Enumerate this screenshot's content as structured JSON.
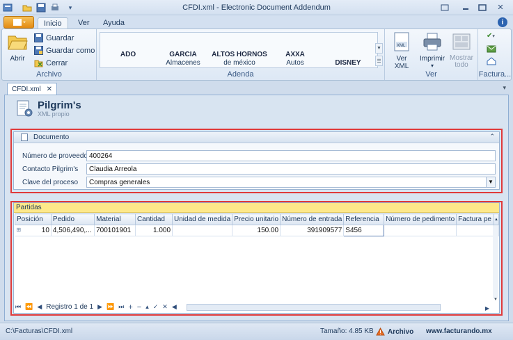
{
  "window": {
    "title": "CFDI.xml - Electronic Document Addendum"
  },
  "ribbon_tabs": [
    {
      "label": "Inicio",
      "active": true
    },
    {
      "label": "Ver",
      "active": false
    },
    {
      "label": "Ayuda",
      "active": false
    }
  ],
  "archivo": {
    "group_label": "Archivo",
    "abrir": "Abrir",
    "guardar": "Guardar",
    "guardar_como": "Guardar como",
    "cerrar": "Cerrar"
  },
  "adenda": {
    "group_label": "Adenda",
    "items": [
      {
        "name": "ADO",
        "sub": ""
      },
      {
        "name": "GARCIA",
        "sub": "Almacenes"
      },
      {
        "name": "ALTOS HORNOS",
        "sub": "de méxico"
      },
      {
        "name": "AXXA",
        "sub": "Autos"
      },
      {
        "name": "DISNEY",
        "sub": ""
      }
    ]
  },
  "ver": {
    "group_label": "Ver",
    "ver_xml": "Ver XML",
    "imprimir": "Imprimir",
    "mostrar_todo_1": "Mostrar",
    "mostrar_todo_2": "todo"
  },
  "factura": {
    "group_label": "Factura..."
  },
  "doc_tab": {
    "label": "CFDI.xml"
  },
  "header": {
    "title": "Pilgrim's",
    "subtitle": "XML propio"
  },
  "documento": {
    "title": "Documento",
    "fields": [
      {
        "label": "Número de proveedor",
        "value": "400264"
      },
      {
        "label": "Contacto Pilgrim's",
        "value": "Claudia Arreola"
      },
      {
        "label": "Clave del proceso",
        "value": "Compras generales"
      }
    ]
  },
  "partidas": {
    "title": "Partidas",
    "columns": [
      "Posición",
      "Pedido",
      "Material",
      "Cantidad",
      "Unidad de medida",
      "Precio unitario",
      "Número de entrada",
      "Referencia",
      "Número de pedimento",
      "Factura pe"
    ],
    "rows": [
      [
        "10",
        "4,506,490,...",
        "700101901",
        "1.000",
        "",
        "150.00",
        "391909577",
        "S456",
        "",
        ""
      ]
    ],
    "record_label": "Registro 1 de 1"
  },
  "status": {
    "path": "C:\\Facturas\\CFDI.xml",
    "size": "Tamaño: 4.85 KB",
    "archivo": "Archivo",
    "web": "www.facturando.mx"
  }
}
